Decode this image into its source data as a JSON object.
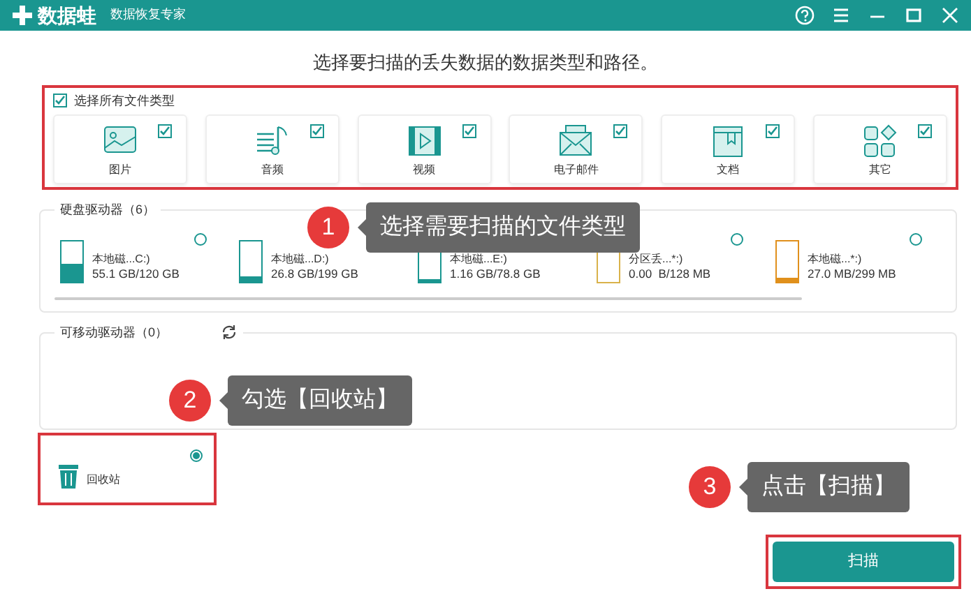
{
  "window": {
    "app_name": "数据蛙",
    "subtitle": "数据恢复专家"
  },
  "heading": "选择要扫描的丢失数据的数据类型和路径。",
  "file_types": {
    "select_all": {
      "label": "选择所有文件类型",
      "checked": true
    },
    "items": [
      {
        "label": "图片",
        "kind": "image",
        "checked": true
      },
      {
        "label": "音频",
        "kind": "audio",
        "checked": true
      },
      {
        "label": "视频",
        "kind": "video",
        "checked": true
      },
      {
        "label": "电子邮件",
        "kind": "email",
        "checked": true
      },
      {
        "label": "文档",
        "kind": "document",
        "checked": true
      },
      {
        "label": "其它",
        "kind": "other",
        "checked": true
      }
    ]
  },
  "hard_drives": {
    "title": "硬盘驱动器（6）",
    "drives": [
      {
        "label": "本地磁...C:)",
        "usage": "55.1 GB/120 GB",
        "level": 0.46,
        "color": "#1a9690",
        "selected": false
      },
      {
        "label": "本地磁...D:)",
        "usage": "26.8 GB/199 GB",
        "level": 0.13,
        "color": "#1a9690"
      },
      {
        "label": "本地磁...E:)",
        "usage": "1.16 GB/78.8 GB",
        "level": 0.02,
        "color": "#1a9690"
      },
      {
        "label": "分区丢...*:)",
        "usage": "0.00  B/128 MB",
        "level": 0,
        "color": "#d9b24a",
        "selected": false
      },
      {
        "label": "本地磁...*:)",
        "usage": "27.0 MB/299 MB",
        "level": 0.09,
        "color": "#e0901c",
        "selected": false
      }
    ]
  },
  "removable": {
    "title": "可移动驱动器（0）"
  },
  "recycle_bin": {
    "label": "回收站",
    "selected": true
  },
  "annotations": [
    {
      "number": "1",
      "text": "选择需要扫描的文件类型"
    },
    {
      "number": "2",
      "text": "勾选【回收站】"
    },
    {
      "number": "3",
      "text": "点击【扫描】"
    }
  ],
  "scan_button": "扫描"
}
